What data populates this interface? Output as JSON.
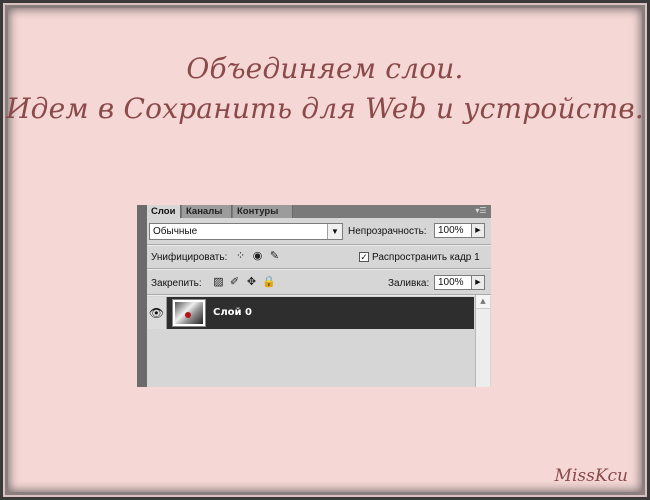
{
  "slide": {
    "heading_line1": "Объединяем слои.",
    "heading_line2": "Идем в Сохранить для Web и устройств.",
    "signature": "MissKcu"
  },
  "layers_panel": {
    "tabs": [
      {
        "label": "Слои",
        "active": true
      },
      {
        "label": "Каналы",
        "active": false
      },
      {
        "label": "Контуры",
        "active": false
      }
    ],
    "menu_icon": "panel-menu-icon",
    "blend_mode": "Обычные",
    "opacity_label": "Непрозрачность:",
    "opacity_value": "100%",
    "unify_label": "Унифицировать:",
    "propagate_label": "Распространить кадр 1",
    "propagate_checked": true,
    "lock_label": "Закрепить:",
    "fill_label": "Заливка:",
    "fill_value": "100%",
    "layers": [
      {
        "name": "Слой 0",
        "visible": true,
        "selected": true
      }
    ]
  },
  "colors": {
    "background": "#f5d7d5",
    "heading": "#8a4a4a",
    "selected_layer": "#2e2e2e"
  }
}
